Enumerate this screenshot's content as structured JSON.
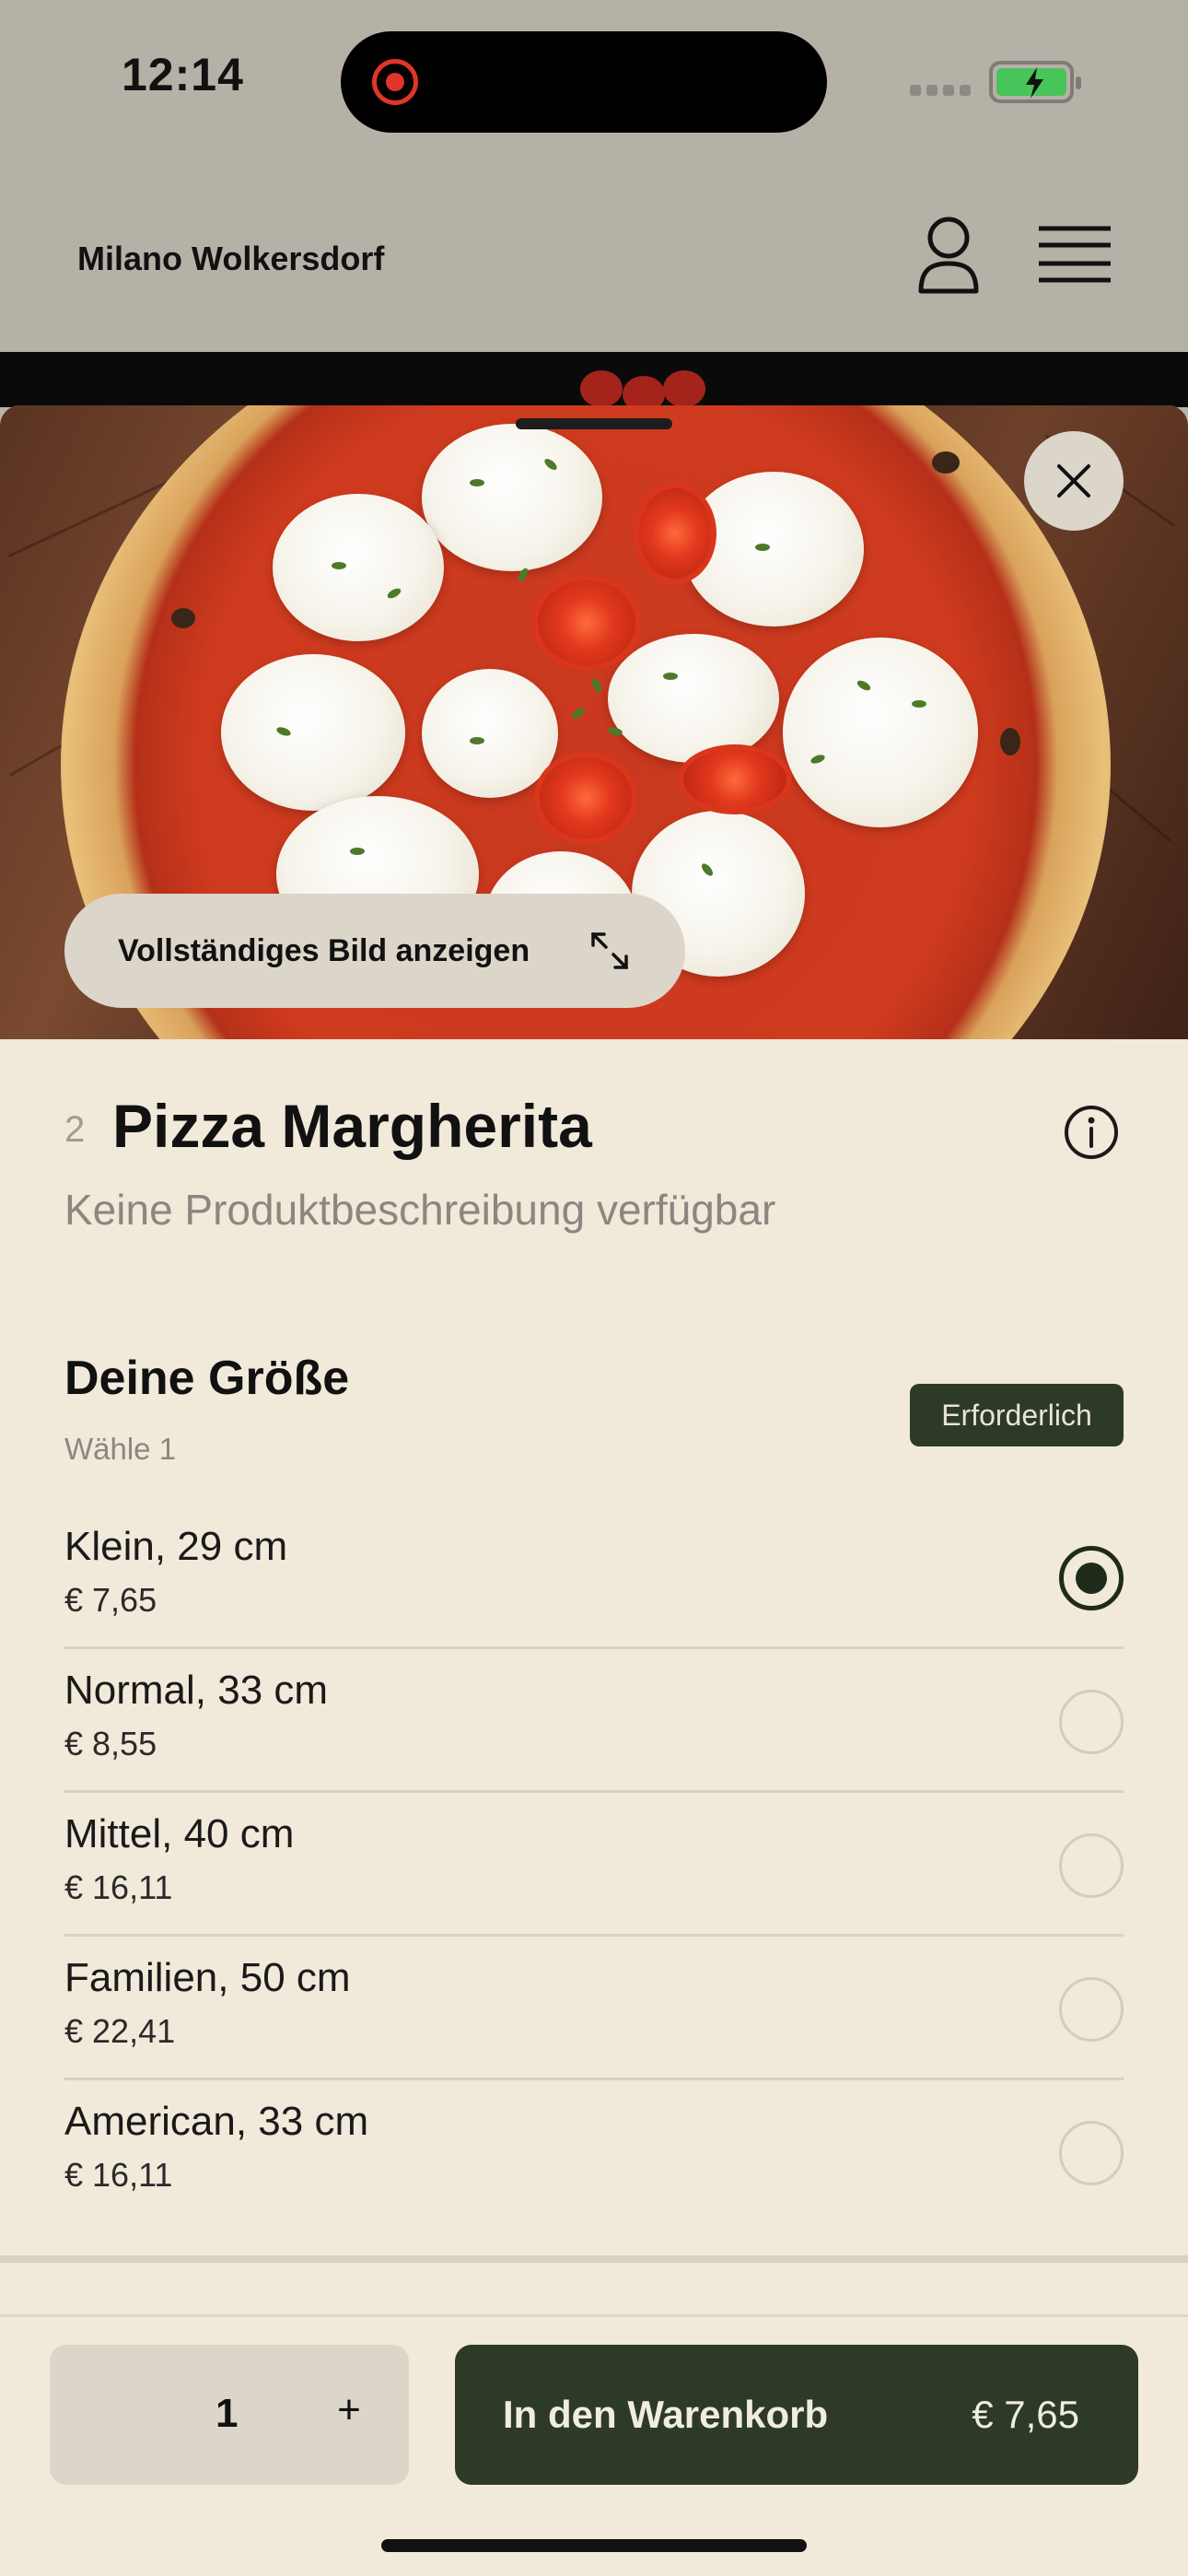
{
  "status_bar": {
    "time": "12:14",
    "battery_color": "#47c45a",
    "recording_color": "#e0352b"
  },
  "header": {
    "store_name": "Milano Wolkersdorf",
    "user_icon": "user-icon",
    "menu_icon": "hamburger-menu-icon"
  },
  "hero": {
    "full_image_label": "Vollständiges Bild anzeigen",
    "close_icon": "close-icon",
    "expand_icon": "expand-icon"
  },
  "product": {
    "number": "2",
    "title": "Pizza Margherita",
    "description": "Keine Produktbeschreibung verfügbar",
    "info_icon": "info-icon"
  },
  "size_group": {
    "title": "Deine Größe",
    "subtitle": "Wähle 1",
    "badge": "Erforderlich",
    "options": [
      {
        "name": "Klein, 29 cm",
        "price": "€ 7,65",
        "selected": true
      },
      {
        "name": "Normal, 33 cm",
        "price": "€ 8,55",
        "selected": false
      },
      {
        "name": "Mittel, 40 cm",
        "price": "€ 16,11",
        "selected": false
      },
      {
        "name": "Familien, 50 cm",
        "price": "€ 22,41",
        "selected": false
      },
      {
        "name": "American, 33 cm",
        "price": "€ 16,11",
        "selected": false
      }
    ]
  },
  "cart": {
    "quantity": "1",
    "plus": "+",
    "add_label": "In den Warenkorb",
    "total": "€ 7,65"
  },
  "colors": {
    "accent": "#2d3a27",
    "sheet_bg": "#f1e9da",
    "header_bg": "#b6b1a7"
  }
}
